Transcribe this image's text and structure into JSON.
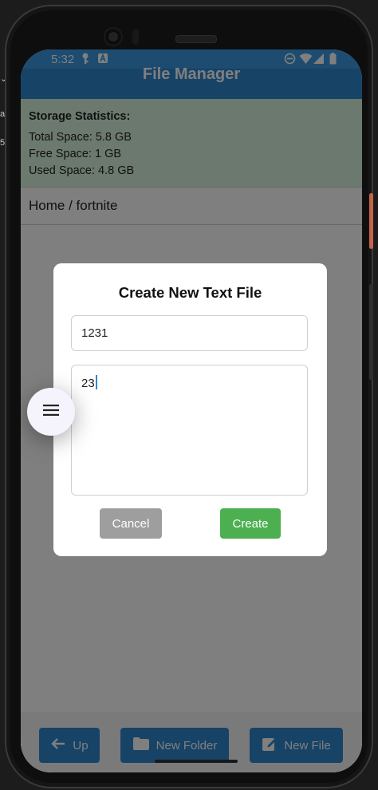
{
  "status_bar": {
    "time": "5:32"
  },
  "app_bar": {
    "title": "File Manager"
  },
  "storage": {
    "heading": "Storage Statistics:",
    "total": "Total Space: 5.8 GB",
    "free": "Free Space: 1 GB",
    "used": "Used Space: 4.8 GB"
  },
  "breadcrumb": "Home / fortnite",
  "dialog": {
    "title": "Create New Text File",
    "name_value": "1231",
    "content_value": "23",
    "cancel_label": "Cancel",
    "create_label": "Create"
  },
  "bottom_bar": {
    "up_label": "Up",
    "new_folder_label": "New Folder",
    "new_file_label": "New File"
  },
  "backdrop": {
    "left_text_a": "a",
    "left_text_b": "5"
  },
  "colors": {
    "status_blue": "#3a98e0",
    "app_bar_blue": "#2e86cf",
    "stats_green": "#d9f3dc",
    "create_green": "#4caf50",
    "cancel_grey": "#9e9e9e"
  },
  "icons": [
    "key-icon",
    "a-badge-icon",
    "dnd-icon",
    "wifi-icon",
    "signal-icon",
    "battery-icon",
    "arrow-left-icon",
    "folder-icon",
    "edit-file-icon",
    "menu-icon"
  ]
}
